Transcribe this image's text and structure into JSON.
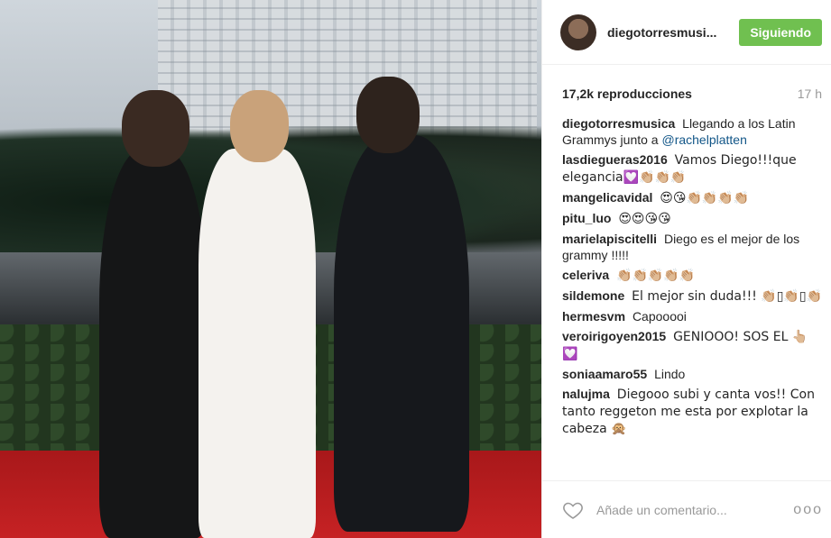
{
  "post": {
    "username": "diegotorresmusi...",
    "follow_label": "Siguiendo",
    "views": "17,2k reproducciones",
    "time": "17 h"
  },
  "comments": [
    {
      "user": "diegotorresmusica",
      "text": "Llegando a los Latin Grammys junto a",
      "mention": "@rachelplatten"
    },
    {
      "user": "lasdiegueras2016",
      "text": "Vamos Diego!!!que elegancia💟👏🏼👏🏼👏🏼"
    },
    {
      "user": "mangelicavidal",
      "text": "😍😘👏🏼👏🏼👏🏼👏🏼"
    },
    {
      "user": "pitu_luo",
      "text": "😍😍😘😘"
    },
    {
      "user": "marielapiscitelli",
      "text": "Diego es el mejor de los grammy !!!!!"
    },
    {
      "user": "celeriva",
      "text": "👏🏼👏🏼👏🏼👏🏼👏🏼"
    },
    {
      "user": "sildemone",
      "text": "El mejor sin duda!!! 👏🏼▯👏🏼▯👏🏼"
    },
    {
      "user": "hermesvm",
      "text": "Capooooi"
    },
    {
      "user": "veroirigoyen2015",
      "text": "GENIOOO! SOS EL 👆🏼💟"
    },
    {
      "user": "soniaamaro55",
      "text": "Lindo"
    },
    {
      "user": "nalujma",
      "text": "Diegooo subi y canta vos!! Con tanto reggeton me esta por explotar la cabeza 🙊"
    }
  ],
  "footer": {
    "placeholder": "Añade un comentario...",
    "more": "ooo"
  }
}
